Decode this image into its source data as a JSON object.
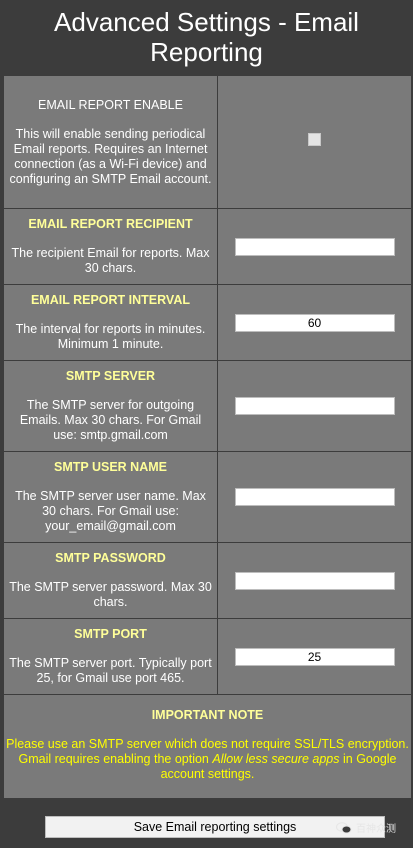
{
  "page": {
    "title": "Advanced Settings - Email Reporting"
  },
  "settings": [
    {
      "title": "EMAIL REPORT ENABLE",
      "description": "This will enable sending periodical Email reports. Requires an Internet connection (as a Wi-Fi device) and configuring an SMTP Email account.",
      "control": "checkbox",
      "checked": false
    },
    {
      "title": "EMAIL REPORT RECIPIENT",
      "description": "The recipient Email for reports. Max 30 chars.",
      "control": "text",
      "value": ""
    },
    {
      "title": "EMAIL REPORT INTERVAL",
      "description": "The interval for reports in minutes. Minimum 1 minute.",
      "control": "text",
      "value": "60"
    },
    {
      "title": "SMTP SERVER",
      "description": "The SMTP server for outgoing Emails. Max 30 chars. For Gmail use: smtp.gmail.com",
      "control": "text",
      "value": ""
    },
    {
      "title": "SMTP USER NAME",
      "description": "The SMTP server user name. Max 30 chars. For Gmail use: your_email@gmail.com",
      "control": "text",
      "value": ""
    },
    {
      "title": "SMTP PASSWORD",
      "description": "The SMTP server password. Max 30 chars.",
      "control": "text",
      "value": ""
    },
    {
      "title": "SMTP PORT",
      "description": "The SMTP server port. Typically port 25, for Gmail use port 465.",
      "control": "text",
      "value": "25"
    }
  ],
  "note": {
    "title": "IMPORTANT NOTE",
    "text_before": "Please use an SMTP server which does not require SSL/TLS encryption. Gmail requires enabling the option ",
    "text_emphasis": "Allow less secure apps",
    "text_after": " in Google account settings."
  },
  "save_button": {
    "label": "Save Email reporting settings"
  },
  "watermark": {
    "text": "百神众测",
    "icon": "wechat-icon"
  },
  "colors": {
    "background": "#3c3c3c",
    "panel": "#7a7a7a",
    "title_highlight": "#ffff99",
    "note_text": "#ffff00"
  }
}
